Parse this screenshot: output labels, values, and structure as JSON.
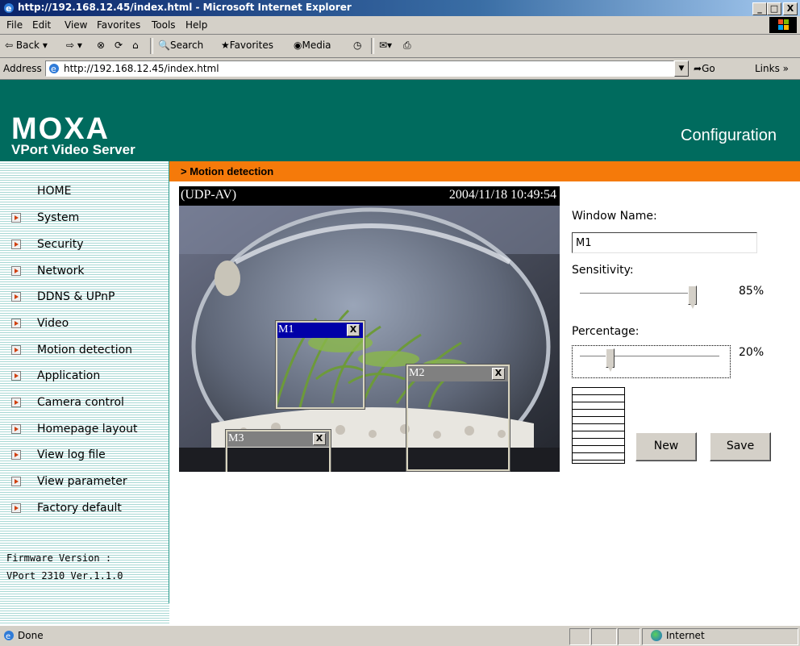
{
  "window": {
    "title": "http://192.168.12.45/index.html - Microsoft Internet Explorer",
    "min": "_",
    "max": "□",
    "close": "X"
  },
  "menu": [
    "File",
    "Edit",
    "View",
    "Favorites",
    "Tools",
    "Help"
  ],
  "toolbar": {
    "back": "Back",
    "search": "Search",
    "favorites": "Favorites",
    "media": "Media"
  },
  "address": {
    "label": "Address",
    "url": "http://192.168.12.45/index.html",
    "go": "Go",
    "links": "Links"
  },
  "header": {
    "brand": "MOXA",
    "product": "VPort Video Server",
    "section": "Configuration"
  },
  "sidebar": {
    "items": [
      {
        "label": "HOME"
      },
      {
        "label": "System"
      },
      {
        "label": "Security"
      },
      {
        "label": "Network"
      },
      {
        "label": "DDNS & UPnP"
      },
      {
        "label": "Video"
      },
      {
        "label": "Motion detection"
      },
      {
        "label": "Application"
      },
      {
        "label": "Camera control"
      },
      {
        "label": "Homepage layout"
      },
      {
        "label": "View log file"
      },
      {
        "label": "View parameter"
      },
      {
        "label": "Factory default"
      }
    ],
    "firmware_label": "Firmware Version :",
    "firmware_value": "VPort 2310 Ver.1.1.0"
  },
  "page": {
    "breadcrumb": "> Motion detection"
  },
  "video": {
    "mode": "(UDP-AV)",
    "timestamp": "2004/11/18 10:49:54",
    "windows": [
      {
        "name": "M1",
        "close": "X"
      },
      {
        "name": "M2",
        "close": "X"
      },
      {
        "name": "M3",
        "close": "X"
      }
    ]
  },
  "settings": {
    "window_name_label": "Window Name:",
    "window_name_value": "M1",
    "sensitivity_label": "Sensitivity:",
    "sensitivity_value": "85%",
    "sensitivity_level": 0.85,
    "percentage_label": "Percentage:",
    "percentage_value": "20%",
    "percentage_level": 0.2,
    "new_button": "New",
    "save_button": "Save"
  },
  "status": {
    "text": "Done",
    "zone": "Internet"
  }
}
